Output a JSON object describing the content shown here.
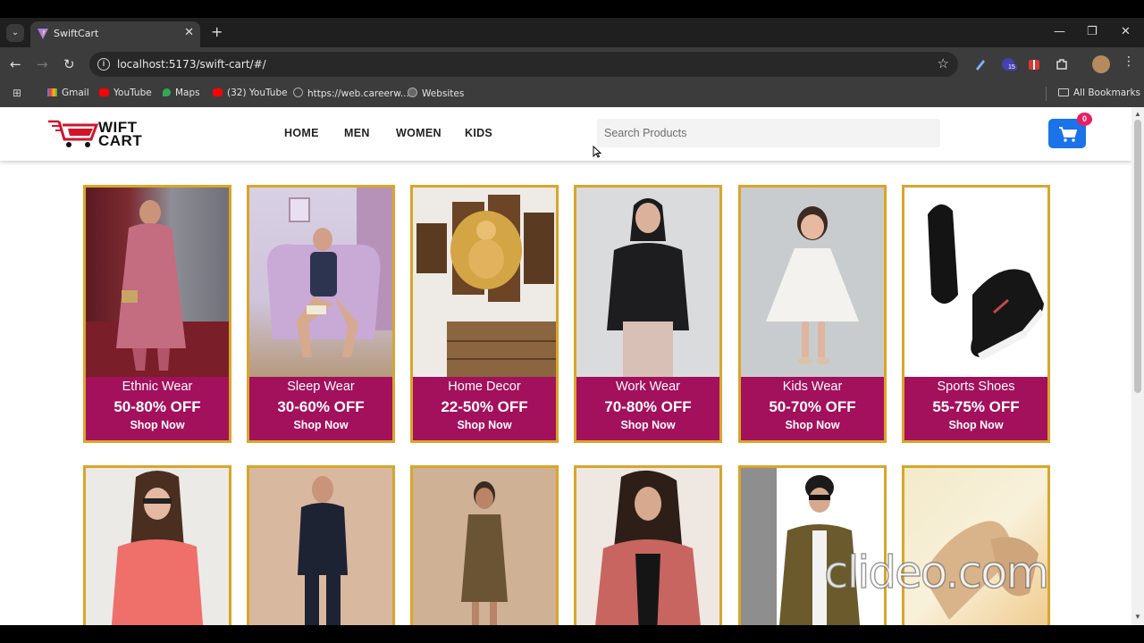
{
  "browser": {
    "tab_title": "SwiftCart",
    "url": "localhost:5173/swift-cart/#/",
    "extension_badge": "15",
    "bookmarks": [
      {
        "label": "Gmail",
        "icon": "gmail-icon"
      },
      {
        "label": "YouTube",
        "icon": "youtube-icon"
      },
      {
        "label": "Maps",
        "icon": "maps-icon"
      },
      {
        "label": "(32) YouTube",
        "icon": "youtube-icon"
      },
      {
        "label": "https://web.careerw...",
        "icon": "globe-icon"
      },
      {
        "label": "Websites",
        "icon": "globe-icon"
      }
    ],
    "all_bookmarks": "All Bookmarks"
  },
  "site": {
    "logo_text_line1": "WIFT",
    "logo_text_line2": "CART",
    "nav": [
      "HOME",
      "MEN",
      "WOMEN",
      "KIDS"
    ],
    "search_placeholder": "Search Products",
    "cart_count": "0",
    "colors": {
      "accent": "#1a73e8",
      "band": "#a3105c",
      "border": "#d9a52a",
      "badge": "#e91e63"
    }
  },
  "categories": [
    {
      "name": "Ethnic Wear",
      "discount": "50-80% OFF",
      "cta": "Shop Now"
    },
    {
      "name": "Sleep Wear",
      "discount": "30-60% OFF",
      "cta": "Shop Now"
    },
    {
      "name": "Home Decor",
      "discount": "22-50% OFF",
      "cta": "Shop Now"
    },
    {
      "name": "Work Wear",
      "discount": "70-80% OFF",
      "cta": "Shop Now"
    },
    {
      "name": "Kids Wear",
      "discount": "50-70% OFF",
      "cta": "Shop Now"
    },
    {
      "name": "Sports Shoes",
      "discount": "55-75% OFF",
      "cta": "Shop Now"
    }
  ],
  "watermark": "clideo.com"
}
